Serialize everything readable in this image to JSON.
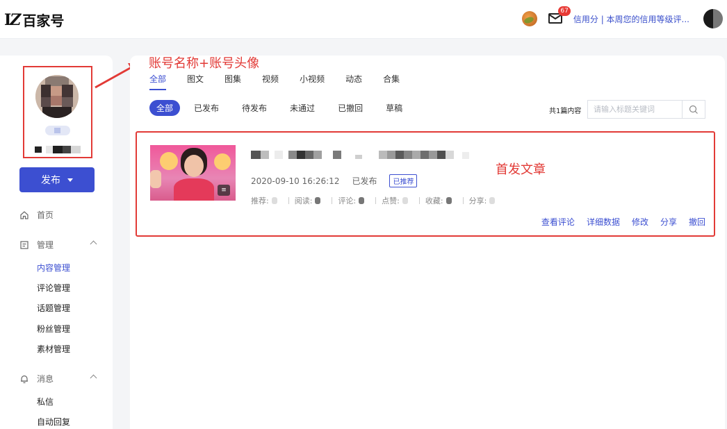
{
  "header": {
    "logo_text": "百家号",
    "mail_badge": "67",
    "credit_text": "信用分 | 本周您的信用等级评..."
  },
  "sidebar": {
    "publish_label": "发布",
    "nav": {
      "home": "首页",
      "manage": "管理",
      "message": "消息"
    },
    "manage_items": [
      "内容管理",
      "评论管理",
      "话题管理",
      "粉丝管理",
      "素材管理"
    ],
    "message_items": [
      "私信",
      "自动回复"
    ]
  },
  "annotations": {
    "account": "账号名称+账号头像",
    "first_article": "首发文章"
  },
  "main": {
    "tabs": [
      "全部",
      "图文",
      "图集",
      "视频",
      "小视频",
      "动态",
      "合集"
    ],
    "filters": [
      "全部",
      "已发布",
      "待发布",
      "未通过",
      "已撤回",
      "草稿"
    ],
    "count_text": "共1篇内容",
    "search_placeholder": "请输入标题关键词",
    "article": {
      "datetime": "2020-09-10 16:26:12",
      "status": "已发布",
      "recommended_tag": "已推荐",
      "stats": {
        "recommend": "推荐:",
        "read": "阅读:",
        "comment": "评论:",
        "like": "点赞:",
        "collect": "收藏:",
        "share": "分享:"
      },
      "actions": [
        "查看评论",
        "详细数据",
        "修改",
        "分享",
        "撤回"
      ]
    }
  },
  "colors": {
    "accent": "#3c4fd1",
    "annotation_red": "#e23a36"
  }
}
